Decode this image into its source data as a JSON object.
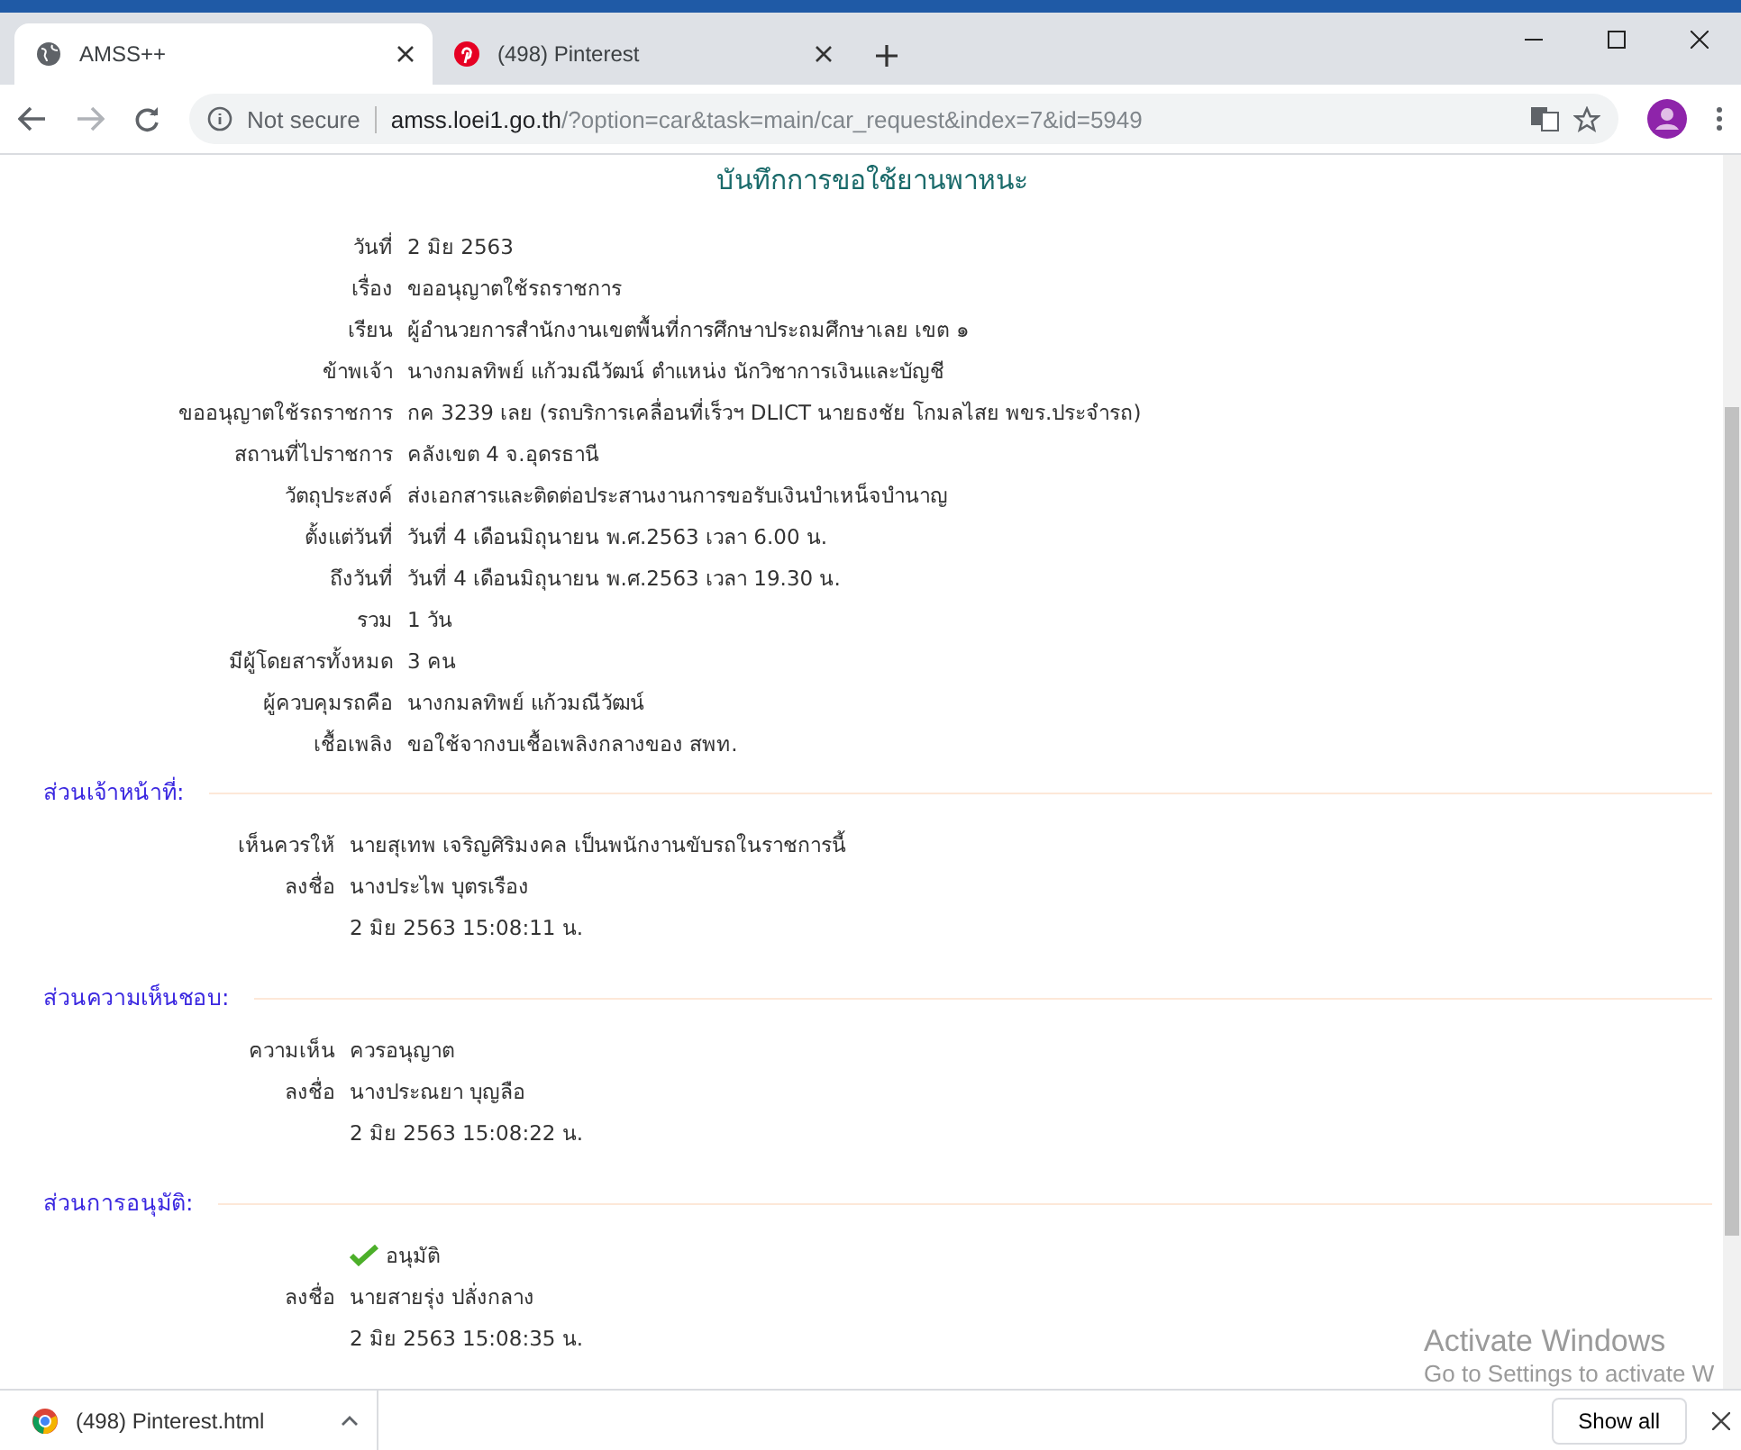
{
  "tabs": [
    {
      "title": "AMSS++",
      "kind": "globe",
      "selected": true
    },
    {
      "title": "(498) Pinterest",
      "kind": "pinterest",
      "selected": false
    }
  ],
  "address_bar": {
    "security": "Not secure",
    "host": "amss.loei1.go.th",
    "path": "/?option=car&task=main/car_request&index=7&id=5949"
  },
  "page": {
    "title": "บันทึกการขอใช้ยานพาหนะ",
    "fields": [
      {
        "label": "วันที่",
        "value": "2 มิย 2563"
      },
      {
        "label": "เรื่อง",
        "value": "ขออนุญาตใช้รถราชการ"
      },
      {
        "label": "เรียน",
        "value": "ผู้อำนวยการสำนักงานเขตพื้นที่การศึกษาประถมศึกษาเลย เขต ๑"
      },
      {
        "label": "ข้าพเจ้า",
        "value": "นางกมลทิพย์  แก้วมณีวัฒน์  ตำแหน่ง  นักวิชาการเงินและบัญชี"
      },
      {
        "label": "ขออนุญาตใช้รถราชการ",
        "value": "กค 3239 เลย (รถบริการเคลื่อนที่เร็วฯ DLICT นายธงชัย โกมลไสย พขร.ประจำรถ)"
      },
      {
        "label": "สถานที่ไปราชการ",
        "value": "คลังเขต 4 จ.อุดรธานี"
      },
      {
        "label": "วัตถุประสงค์",
        "value": "ส่งเอกสารและติดต่อประสานงานการขอรับเงินบำเหน็จบำนาญ"
      },
      {
        "label": "ตั้งแต่วันที่",
        "value": "วันที่ 4 เดือนมิถุนายน พ.ศ.2563  เวลา 6.00 น."
      },
      {
        "label": "ถึงวันที่",
        "value": "วันที่ 4 เดือนมิถุนายน พ.ศ.2563  เวลา 19.30 น."
      },
      {
        "label": "รวม",
        "value": "1  วัน"
      },
      {
        "label": "มีผู้โดยสารทั้งหมด",
        "value": "3  คน"
      },
      {
        "label": "ผู้ควบคุมรถคือ",
        "value": "นางกมลทิพย์  แก้วมณีวัฒน์"
      },
      {
        "label": "เชื้อเพลิง",
        "value": "ขอใช้จากงบเชื้อเพลิงกลางของ สพท."
      }
    ],
    "sections": [
      {
        "legend": "ส่วนเจ้าหน้าที่:",
        "rows": [
          {
            "kind": "field",
            "label": "เห็นควรให้",
            "value": "นายสุเทพ เจริญศิริมงคล เป็นพนักงานขับรถในราชการนี้"
          },
          {
            "kind": "field",
            "label": "ลงชื่อ",
            "value": "นางประไพ  บุตรเรือง"
          },
          {
            "kind": "field",
            "value": "2 มิย 2563 15:08:11 น."
          }
        ]
      },
      {
        "legend": "ส่วนความเห็นชอบ:",
        "rows": [
          {
            "kind": "field",
            "label": "ความเห็น",
            "value": "ควรอนุญาต"
          },
          {
            "kind": "field",
            "label": "ลงชื่อ",
            "value": "นางประณยา  บุญลือ"
          },
          {
            "kind": "field",
            "value": "2 มิย 2563 15:08:22 น."
          }
        ]
      },
      {
        "legend": "ส่วนการอนุมัติ:",
        "rows": [
          {
            "kind": "approved",
            "value": "อนุมัติ"
          },
          {
            "kind": "field",
            "label": "ลงชื่อ",
            "value": "นายสายรุ่ง  ปลั่งกลาง"
          },
          {
            "kind": "field",
            "value": "2 มิย 2563 15:08:35 น."
          }
        ]
      }
    ]
  },
  "downloads": {
    "file": "(498) Pinterest.html",
    "button": "Show all"
  },
  "os_overlay": {
    "title": "Activate Windows",
    "subtitle": "Go to Settings to activate W"
  }
}
